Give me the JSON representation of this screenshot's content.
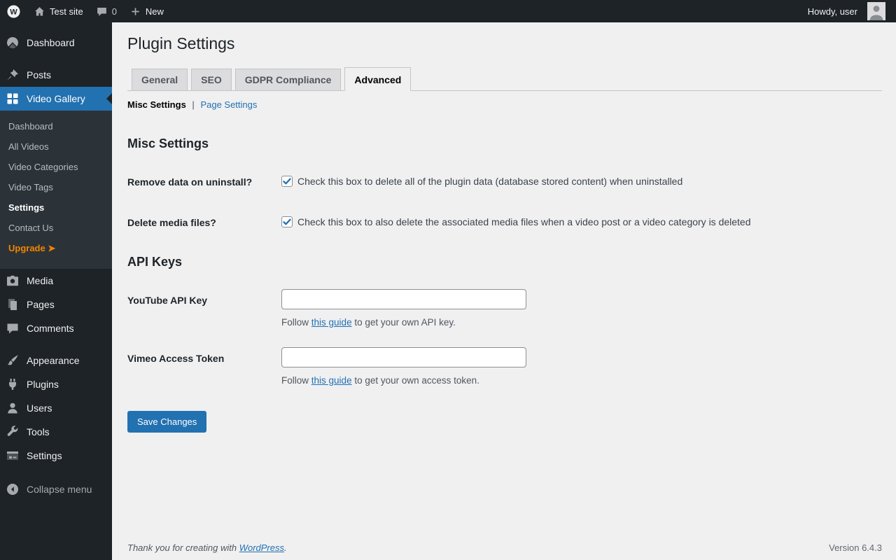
{
  "colors": {
    "accent": "#2271b1",
    "admin_bar_bg": "#1d2327",
    "sidebar_bg": "#1d2327",
    "submenu_bg": "#2c3338",
    "active_menu_bg": "#2271b1",
    "content_bg": "#f0f0f1",
    "upgrade_link": "#f18500",
    "button_bg": "#2271b1"
  },
  "admin_bar": {
    "site_name": "Test site",
    "comment_count": "0",
    "new_label": "New",
    "howdy": "Howdy, user"
  },
  "sidebar": {
    "items": [
      {
        "label": "Dashboard",
        "icon": "dashboard-icon"
      },
      {
        "label": "Posts",
        "icon": "pin-icon"
      },
      {
        "label": "Video Gallery",
        "icon": "video-gallery-icon",
        "active": true
      },
      {
        "label": "Media",
        "icon": "media-icon"
      },
      {
        "label": "Pages",
        "icon": "pages-icon"
      },
      {
        "label": "Comments",
        "icon": "comments-icon"
      },
      {
        "label": "Appearance",
        "icon": "appearance-icon"
      },
      {
        "label": "Plugins",
        "icon": "plugins-icon"
      },
      {
        "label": "Users",
        "icon": "users-icon"
      },
      {
        "label": "Tools",
        "icon": "tools-icon"
      },
      {
        "label": "Settings",
        "icon": "settings-icon"
      }
    ],
    "submenu": {
      "items": [
        {
          "label": "Dashboard"
        },
        {
          "label": "All Videos"
        },
        {
          "label": "Video Categories"
        },
        {
          "label": "Video Tags"
        },
        {
          "label": "Settings",
          "current": true
        },
        {
          "label": "Contact Us"
        },
        {
          "label": "Upgrade ➤",
          "highlight": true
        }
      ]
    },
    "collapse_label": "Collapse menu"
  },
  "page": {
    "title": "Plugin Settings",
    "tabs": [
      {
        "label": "General"
      },
      {
        "label": "SEO"
      },
      {
        "label": "GDPR Compliance"
      },
      {
        "label": "Advanced",
        "active": true
      }
    ],
    "subnav": {
      "current": "Misc Settings",
      "separator": "|",
      "link": "Page Settings"
    },
    "misc_section": {
      "heading": "Misc Settings",
      "rows": [
        {
          "label": "Remove data on uninstall?",
          "checked": true,
          "description": "Check this box to delete all of the plugin data (database stored content) when uninstalled"
        },
        {
          "label": "Delete media files?",
          "checked": true,
          "description": "Check this box to also delete the associated media files when a video post or a video category is deleted"
        }
      ]
    },
    "api_section": {
      "heading": "API Keys",
      "fields": [
        {
          "label": "YouTube API Key",
          "value": "",
          "desc_prefix": "Follow",
          "desc_link": "this guide",
          "desc_suffix": "to get your own API key."
        },
        {
          "label": "Vimeo Access Token",
          "value": "",
          "desc_prefix": "Follow",
          "desc_link": "this guide",
          "desc_suffix": "to get your own access token."
        }
      ]
    },
    "save_button": "Save Changes"
  },
  "footer": {
    "thanks_prefix": "Thank you for creating with",
    "thanks_link": "WordPress",
    "thanks_suffix": ".",
    "version": "Version 6.4.3"
  }
}
